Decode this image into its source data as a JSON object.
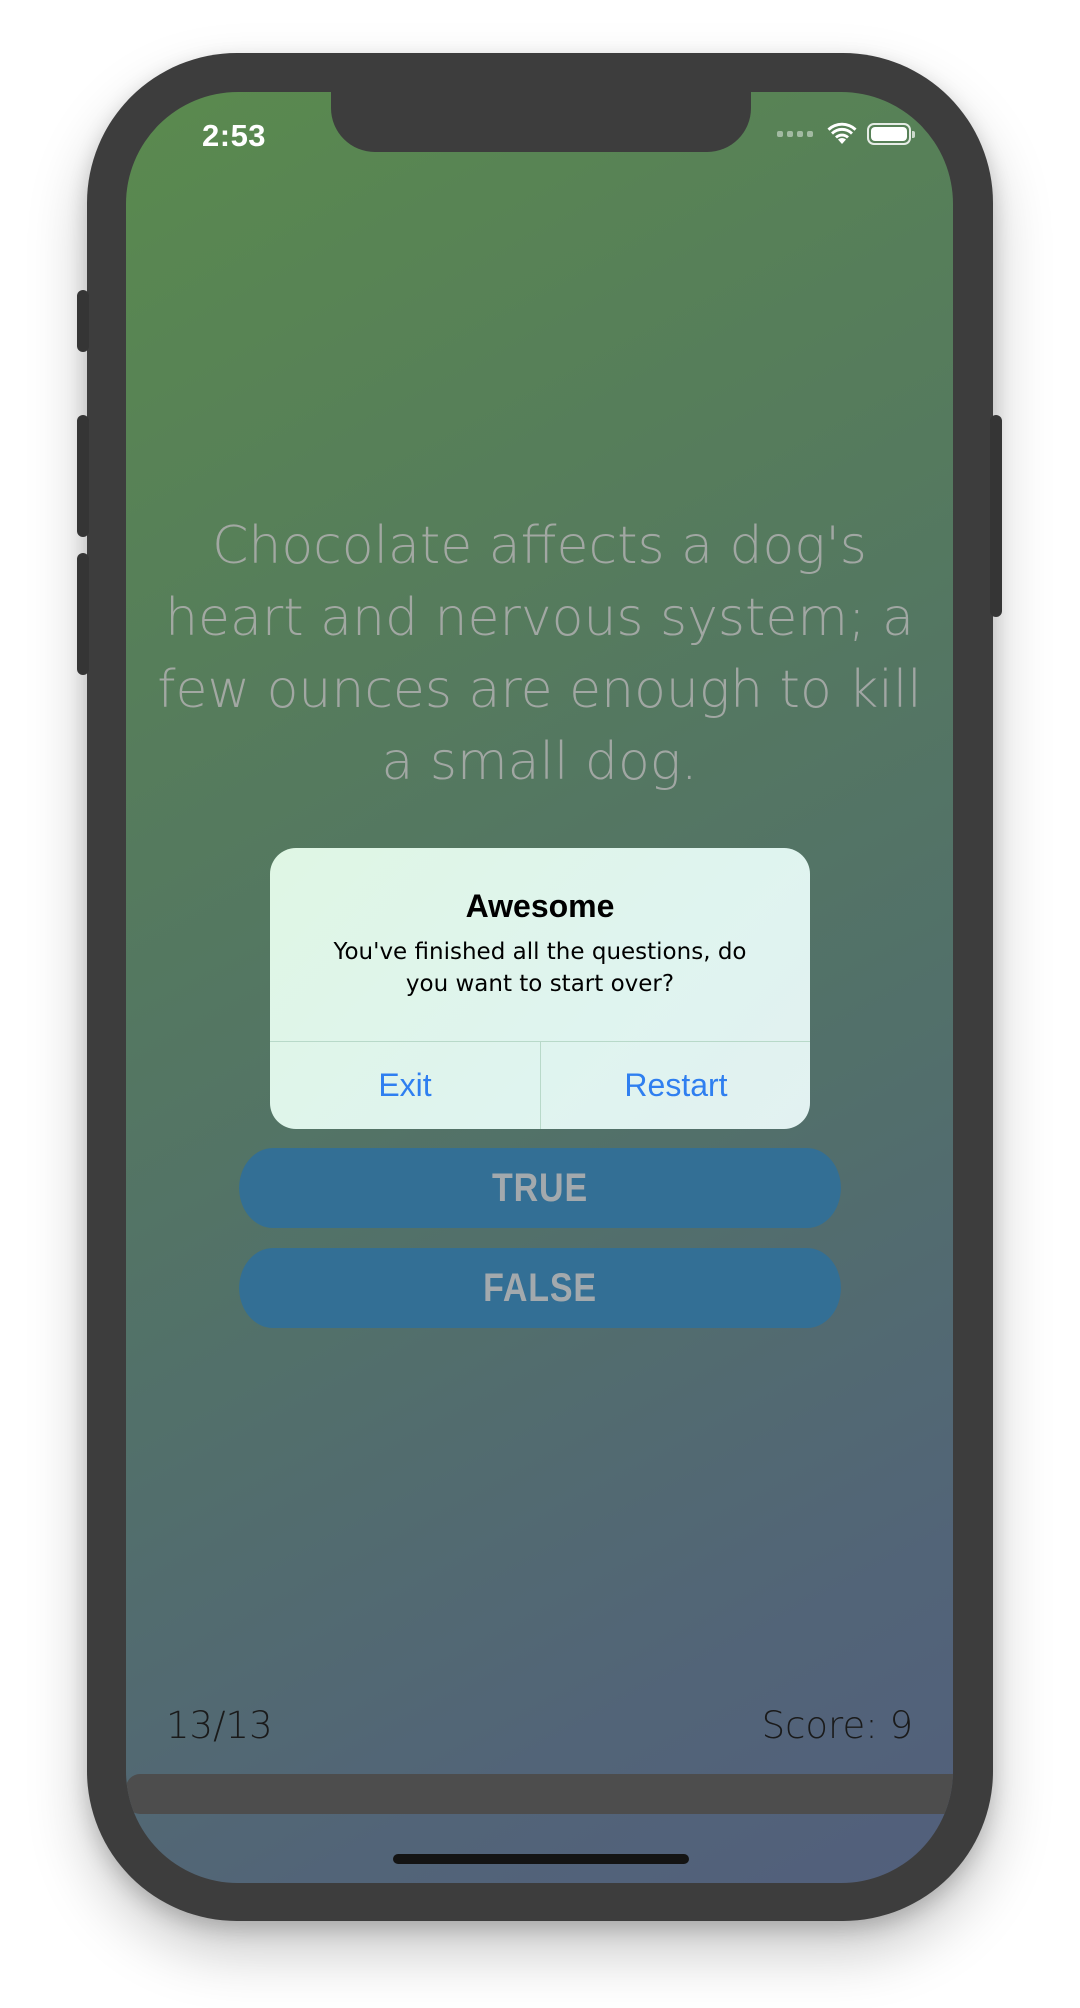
{
  "status_bar": {
    "time": "2:53",
    "icons": [
      "cellular-signal-icon",
      "wifi-icon",
      "battery-icon"
    ],
    "battery_level": 1.0
  },
  "quiz": {
    "question": "Chocolate affects a dog's heart and nervous system; a few ounces are enough to kill a small dog.",
    "true_label": "TRUE",
    "false_label": "FALSE",
    "progress_label": "13/13",
    "score_label": "Score: 9",
    "progress_fraction": 1.0
  },
  "alert": {
    "title": "Awesome",
    "message": "You've finished all the questions, do you want to start over?",
    "exit_label": "Exit",
    "restart_label": "Restart"
  },
  "colors": {
    "gradient_start": "#5a8a4e",
    "gradient_end": "#525f7c",
    "answer_button": "#336f95",
    "alert_action": "#2f7ff0",
    "phone_frame": "#3d3d3d"
  }
}
